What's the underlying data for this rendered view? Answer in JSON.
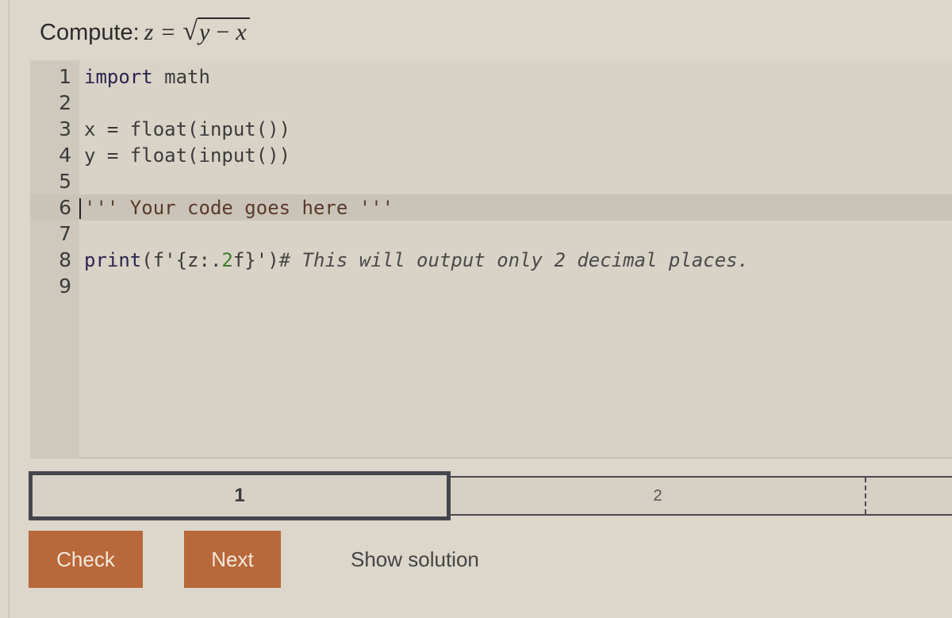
{
  "prompt": {
    "label": "Compute:",
    "formula": {
      "lhs": "z",
      "equals": "=",
      "sqrt_sign": "√",
      "radicand_a": "y",
      "minus": "−",
      "radicand_b": "x"
    }
  },
  "editor": {
    "active_line": 6,
    "lines": [
      {
        "number": "1",
        "tokens": [
          {
            "t": "import",
            "c": "kw"
          },
          {
            "t": " math",
            "c": ""
          }
        ]
      },
      {
        "number": "2",
        "tokens": []
      },
      {
        "number": "3",
        "tokens": [
          {
            "t": "x = float(input())",
            "c": ""
          }
        ]
      },
      {
        "number": "4",
        "tokens": [
          {
            "t": "y = float(input())",
            "c": ""
          }
        ]
      },
      {
        "number": "5",
        "tokens": []
      },
      {
        "number": "6",
        "tokens": [
          {
            "t": "''' Your code goes here '''",
            "c": "str"
          }
        ]
      },
      {
        "number": "7",
        "tokens": []
      },
      {
        "number": "8",
        "tokens": [
          {
            "t": "print",
            "c": "kw"
          },
          {
            "t": "(f'{z:.",
            "c": ""
          },
          {
            "t": "2",
            "c": "num"
          },
          {
            "t": "f}')",
            "c": ""
          },
          {
            "t": "# This will output only 2 decimal places.",
            "c": "cmt"
          }
        ]
      },
      {
        "number": "9",
        "tokens": []
      }
    ]
  },
  "tests": {
    "items": [
      {
        "label": "1",
        "selected": true
      },
      {
        "label": "2",
        "selected": false
      }
    ]
  },
  "actions": {
    "check_label": "Check",
    "next_label": "Next",
    "show_solution_label": "Show solution"
  },
  "colors": {
    "button_bg": "#b8683a",
    "button_text": "#f3e8dc",
    "page_bg": "#dcd6cb"
  }
}
